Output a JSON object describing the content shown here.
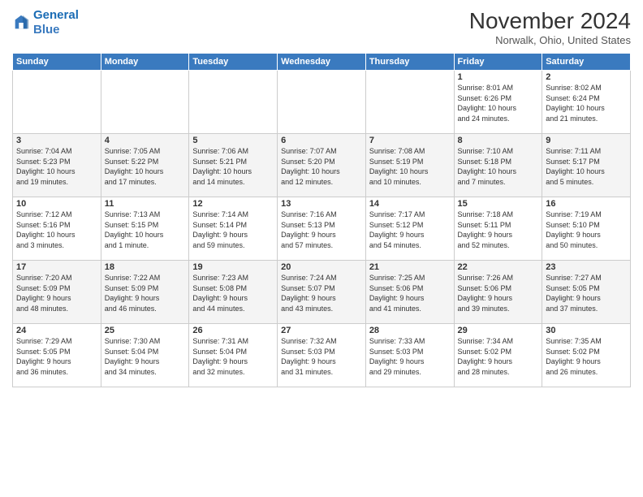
{
  "logo": {
    "line1": "General",
    "line2": "Blue"
  },
  "title": "November 2024",
  "location": "Norwalk, Ohio, United States",
  "days_of_week": [
    "Sunday",
    "Monday",
    "Tuesday",
    "Wednesday",
    "Thursday",
    "Friday",
    "Saturday"
  ],
  "weeks": [
    [
      {
        "day": "",
        "info": ""
      },
      {
        "day": "",
        "info": ""
      },
      {
        "day": "",
        "info": ""
      },
      {
        "day": "",
        "info": ""
      },
      {
        "day": "",
        "info": ""
      },
      {
        "day": "1",
        "info": "Sunrise: 8:01 AM\nSunset: 6:26 PM\nDaylight: 10 hours\nand 24 minutes."
      },
      {
        "day": "2",
        "info": "Sunrise: 8:02 AM\nSunset: 6:24 PM\nDaylight: 10 hours\nand 21 minutes."
      }
    ],
    [
      {
        "day": "3",
        "info": "Sunrise: 7:04 AM\nSunset: 5:23 PM\nDaylight: 10 hours\nand 19 minutes."
      },
      {
        "day": "4",
        "info": "Sunrise: 7:05 AM\nSunset: 5:22 PM\nDaylight: 10 hours\nand 17 minutes."
      },
      {
        "day": "5",
        "info": "Sunrise: 7:06 AM\nSunset: 5:21 PM\nDaylight: 10 hours\nand 14 minutes."
      },
      {
        "day": "6",
        "info": "Sunrise: 7:07 AM\nSunset: 5:20 PM\nDaylight: 10 hours\nand 12 minutes."
      },
      {
        "day": "7",
        "info": "Sunrise: 7:08 AM\nSunset: 5:19 PM\nDaylight: 10 hours\nand 10 minutes."
      },
      {
        "day": "8",
        "info": "Sunrise: 7:10 AM\nSunset: 5:18 PM\nDaylight: 10 hours\nand 7 minutes."
      },
      {
        "day": "9",
        "info": "Sunrise: 7:11 AM\nSunset: 5:17 PM\nDaylight: 10 hours\nand 5 minutes."
      }
    ],
    [
      {
        "day": "10",
        "info": "Sunrise: 7:12 AM\nSunset: 5:16 PM\nDaylight: 10 hours\nand 3 minutes."
      },
      {
        "day": "11",
        "info": "Sunrise: 7:13 AM\nSunset: 5:15 PM\nDaylight: 10 hours\nand 1 minute."
      },
      {
        "day": "12",
        "info": "Sunrise: 7:14 AM\nSunset: 5:14 PM\nDaylight: 9 hours\nand 59 minutes."
      },
      {
        "day": "13",
        "info": "Sunrise: 7:16 AM\nSunset: 5:13 PM\nDaylight: 9 hours\nand 57 minutes."
      },
      {
        "day": "14",
        "info": "Sunrise: 7:17 AM\nSunset: 5:12 PM\nDaylight: 9 hours\nand 54 minutes."
      },
      {
        "day": "15",
        "info": "Sunrise: 7:18 AM\nSunset: 5:11 PM\nDaylight: 9 hours\nand 52 minutes."
      },
      {
        "day": "16",
        "info": "Sunrise: 7:19 AM\nSunset: 5:10 PM\nDaylight: 9 hours\nand 50 minutes."
      }
    ],
    [
      {
        "day": "17",
        "info": "Sunrise: 7:20 AM\nSunset: 5:09 PM\nDaylight: 9 hours\nand 48 minutes."
      },
      {
        "day": "18",
        "info": "Sunrise: 7:22 AM\nSunset: 5:09 PM\nDaylight: 9 hours\nand 46 minutes."
      },
      {
        "day": "19",
        "info": "Sunrise: 7:23 AM\nSunset: 5:08 PM\nDaylight: 9 hours\nand 44 minutes."
      },
      {
        "day": "20",
        "info": "Sunrise: 7:24 AM\nSunset: 5:07 PM\nDaylight: 9 hours\nand 43 minutes."
      },
      {
        "day": "21",
        "info": "Sunrise: 7:25 AM\nSunset: 5:06 PM\nDaylight: 9 hours\nand 41 minutes."
      },
      {
        "day": "22",
        "info": "Sunrise: 7:26 AM\nSunset: 5:06 PM\nDaylight: 9 hours\nand 39 minutes."
      },
      {
        "day": "23",
        "info": "Sunrise: 7:27 AM\nSunset: 5:05 PM\nDaylight: 9 hours\nand 37 minutes."
      }
    ],
    [
      {
        "day": "24",
        "info": "Sunrise: 7:29 AM\nSunset: 5:05 PM\nDaylight: 9 hours\nand 36 minutes."
      },
      {
        "day": "25",
        "info": "Sunrise: 7:30 AM\nSunset: 5:04 PM\nDaylight: 9 hours\nand 34 minutes."
      },
      {
        "day": "26",
        "info": "Sunrise: 7:31 AM\nSunset: 5:04 PM\nDaylight: 9 hours\nand 32 minutes."
      },
      {
        "day": "27",
        "info": "Sunrise: 7:32 AM\nSunset: 5:03 PM\nDaylight: 9 hours\nand 31 minutes."
      },
      {
        "day": "28",
        "info": "Sunrise: 7:33 AM\nSunset: 5:03 PM\nDaylight: 9 hours\nand 29 minutes."
      },
      {
        "day": "29",
        "info": "Sunrise: 7:34 AM\nSunset: 5:02 PM\nDaylight: 9 hours\nand 28 minutes."
      },
      {
        "day": "30",
        "info": "Sunrise: 7:35 AM\nSunset: 5:02 PM\nDaylight: 9 hours\nand 26 minutes."
      }
    ]
  ]
}
